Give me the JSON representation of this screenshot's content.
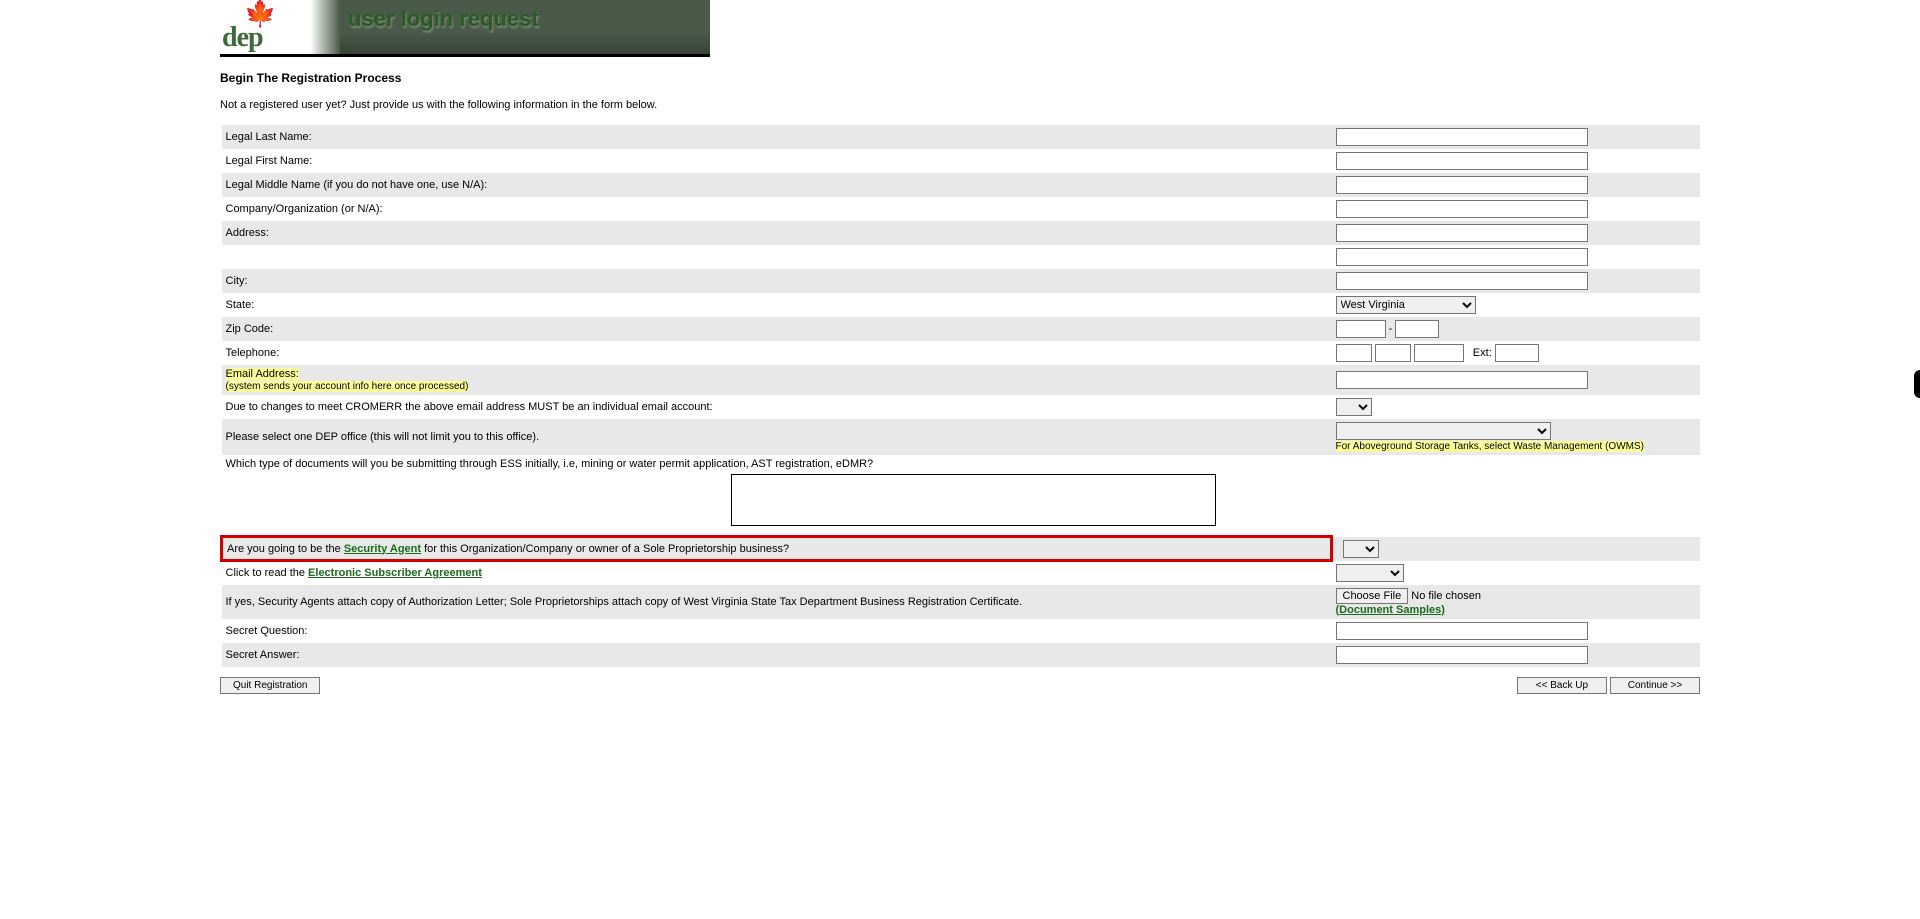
{
  "banner": {
    "title": "user login request",
    "logo_alt": "dep"
  },
  "heading": "Begin The Registration Process",
  "intro": "Not a registered user yet? Just provide us with the following information in the form below.",
  "labels": {
    "last": "Legal Last Name:",
    "first": "Legal First Name:",
    "middle": "Legal Middle Name (if you do not have one, use N/A):",
    "company": "Company/Organization (or N/A):",
    "address": "Address:",
    "city": "City:",
    "state": "State:",
    "zip": "Zip Code:",
    "phone": "Telephone:",
    "ext": "Ext:",
    "email": "Email Address:",
    "email_note": "(system sends your account info here once processed)",
    "cromerr": "Due to changes to meet CROMERR the above email address MUST be an individual email account:",
    "office": "Please select one DEP office (this will not limit you to this office).",
    "office_note": "For Aboveground Storage Tanks, select Waste Management (OWMS)",
    "docs": "Which type of documents will you be submitting through ESS initially, i.e, mining or water permit application, AST registration, eDMR?",
    "sec_pre": "Are you going to be the ",
    "sec_link": "Security Agent",
    "sec_post": " for this Organization/Company or owner of a Sole Proprietorship business?",
    "esa_pre": "Click to read the ",
    "esa_link": "Electronic Subscriber Agreement",
    "attach": "If yes, Security Agents attach copy of Authorization Letter; Sole Proprietorships attach copy of West Virginia State Tax Department Business Registration Certificate.",
    "choose_file": "Choose File",
    "no_file": "No file chosen",
    "samples": "(Document Samples)",
    "secret_q": "Secret Question:",
    "secret_a": "Secret Answer:"
  },
  "values": {
    "state_selected": "West Virginia",
    "zip_dash": "-"
  },
  "buttons": {
    "quit": "Quit Registration",
    "back": "<<  Back Up",
    "cont": "Continue >>"
  }
}
